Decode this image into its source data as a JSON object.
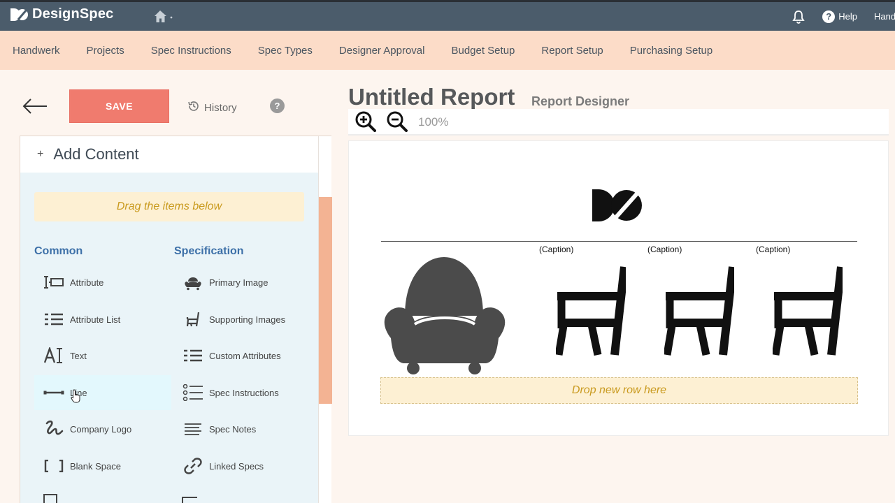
{
  "topbar": {
    "app_name": "DesignSpec",
    "help_label": "Help",
    "user_name": "Handwerk"
  },
  "nav": {
    "items": [
      "Handwerk",
      "Projects",
      "Spec Instructions",
      "Spec Types",
      "Designer Approval",
      "Budget Setup",
      "Report Setup",
      "Purchasing Setup"
    ]
  },
  "toolbar": {
    "save_label": "SAVE",
    "history_label": "History",
    "help_mark": "?"
  },
  "panel": {
    "plus": "+",
    "title": "Add Content",
    "drag_hint": "Drag the items below",
    "common_heading": "Common",
    "spec_heading": "Specification",
    "common_items": [
      {
        "label": "Attribute",
        "icon": "attribute-icon"
      },
      {
        "label": "Attribute List",
        "icon": "attribute-list-icon"
      },
      {
        "label": "Text",
        "icon": "text-icon"
      },
      {
        "label": "Line",
        "icon": "line-icon"
      },
      {
        "label": "Company Logo",
        "icon": "company-logo-icon"
      },
      {
        "label": "Blank Space",
        "icon": "blank-space-icon"
      }
    ],
    "spec_items": [
      {
        "label": "Primary Image",
        "icon": "armchair-icon"
      },
      {
        "label": "Supporting Images",
        "icon": "chair-icon"
      },
      {
        "label": "Custom Attributes",
        "icon": "custom-attributes-icon"
      },
      {
        "label": "Spec Instructions",
        "icon": "list-icon"
      },
      {
        "label": "Spec Notes",
        "icon": "notes-icon"
      },
      {
        "label": "Linked Specs",
        "icon": "link-icon"
      }
    ]
  },
  "report": {
    "title": "Untitled Report",
    "subtitle": "Report Designer",
    "zoom_level": "100%",
    "captions": [
      "(Caption)",
      "(Caption)",
      "(Caption)"
    ],
    "drop_hint": "Drop new row here"
  },
  "colors": {
    "topbar": "#4b5c6b",
    "nav": "#fcdcc8",
    "save": "#f07b6e",
    "accent_blue": "#3d70a8",
    "hint_text": "#c99a1e"
  }
}
